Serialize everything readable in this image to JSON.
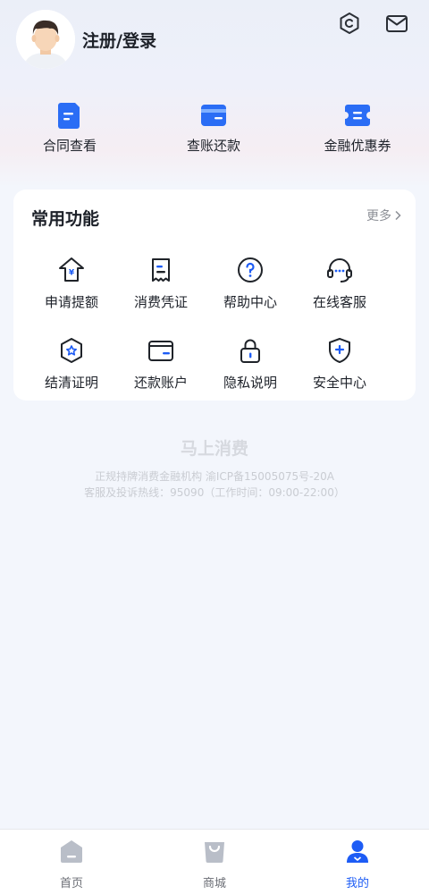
{
  "header": {
    "login_text": "注册/登录",
    "avatar_icon": "user-avatar",
    "settings_icon": "settings-icon",
    "mail_icon": "mail-icon"
  },
  "quick_actions": [
    {
      "label": "合同查看",
      "icon": "contract-doc-icon"
    },
    {
      "label": "查账还款",
      "icon": "card-bill-icon"
    },
    {
      "label": "金融优惠券",
      "icon": "coupon-icon"
    }
  ],
  "functions": {
    "title": "常用功能",
    "more": "更多",
    "items": [
      {
        "label": "申请提额",
        "icon": "raise-limit-icon"
      },
      {
        "label": "消费凭证",
        "icon": "receipt-icon"
      },
      {
        "label": "帮助中心",
        "icon": "help-icon"
      },
      {
        "label": "在线客服",
        "icon": "headset-icon"
      },
      {
        "label": "结清证明",
        "icon": "certificate-icon"
      },
      {
        "label": "还款账户",
        "icon": "wallet-icon"
      },
      {
        "label": "隐私说明",
        "icon": "lock-icon"
      },
      {
        "label": "安全中心",
        "icon": "shield-icon"
      }
    ]
  },
  "footer": {
    "brand": "马上消费",
    "line1": "正规持牌消费金融机构 渝ICP备15005075号-20A",
    "line2": "客服及投诉热线：95090（工作时间：09:00-22:00）"
  },
  "tabbar": [
    {
      "label": "首页",
      "icon": "home-icon",
      "active": false
    },
    {
      "label": "商城",
      "icon": "shop-bag-icon",
      "active": false
    },
    {
      "label": "我的",
      "icon": "profile-icon",
      "active": true
    }
  ],
  "colors": {
    "accent": "#1d5cf5",
    "text": "#1d2129",
    "muted": "#8c8f96"
  }
}
